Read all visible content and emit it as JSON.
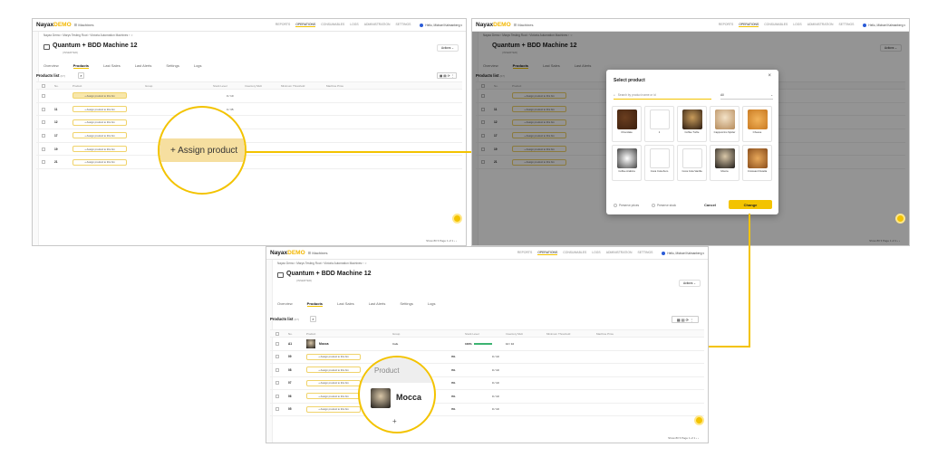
{
  "app": {
    "logo_main": "Nayax",
    "logo_accent": "DEMO",
    "app_name": "☰ Machines",
    "nav": [
      "REPORTS",
      "OPERATIONS",
      "CONSUMABLES",
      "LOGS",
      "ADMINISTRATION",
      "SETTINGS"
    ],
    "active_nav": "OPERATIONS",
    "user": "Hello, Michael Kalmanberg ▾"
  },
  "page": {
    "breadcrumbs": "Nayax Demo  ›  Marys Testing Root  ›  Victoria Automation Machines  ›  ☆",
    "title": "Quantum + BDD Machine 12",
    "subtitle": "(INSERTED)",
    "actions": "Actions ⌄",
    "tabs": [
      "Overview",
      "Products",
      "Last Sales",
      "Last Alerts",
      "Settings",
      "Logs"
    ],
    "active_tab": "Products",
    "products_list_label": "Products list",
    "products_count": "(07)",
    "columns": [
      "No.",
      "Product",
      "Group",
      "Stock Level",
      "Inventory Mult",
      "Minimum Threshold",
      "Machine Price"
    ],
    "assign_label": "+ Assign product to this bin",
    "status": "Show 80 ▾   Page 1 of 1   ‹  ›"
  },
  "panel1": {
    "rows": [
      {
        "no": "",
        "cap": "0 / 10"
      },
      {
        "no": "11",
        "cap": "0 / 35"
      },
      {
        "no": "12",
        "cap": "0 / 35"
      },
      {
        "no": "17",
        "cap": "0 / 10"
      },
      {
        "no": "19",
        "cap": "0 / 10"
      },
      {
        "no": "21",
        "cap": "0 / 10"
      }
    ],
    "fill_badge": "0%",
    "zoom_label": "+  Assign product"
  },
  "modal": {
    "title": "Select product",
    "search_placeholder": "Search by product name or id",
    "filter_value": "All",
    "close": "×",
    "products": [
      "Chocolate",
      "1",
      "Coffee Turtle",
      "Cappuccino Spider",
      "Cheese",
      "Coffee Arabica",
      "Coca Cola Zero",
      "Coca Cola Vanilla",
      "Mocca",
      "Croissant Nutella"
    ],
    "preserve_prices": "Preserve prices",
    "preserve_stock": "Preserve stock",
    "cancel": "Cancel",
    "change": "Change"
  },
  "panel3": {
    "rows": [
      {
        "no": "A1",
        "product": "Mocca",
        "group": "Cafe",
        "fill": "100%",
        "cap": "10 / 10"
      },
      {
        "no": "09",
        "product": "",
        "group": "",
        "fill": "0%",
        "cap": "0 / 10"
      },
      {
        "no": "08",
        "product": "",
        "group": "",
        "fill": "0%",
        "cap": "0 / 10"
      },
      {
        "no": "07",
        "product": "",
        "group": "",
        "fill": "0%",
        "cap": "0 / 10"
      },
      {
        "no": "06",
        "product": "",
        "group": "",
        "fill": "0%",
        "cap": "0 / 10"
      },
      {
        "no": "05",
        "product": "",
        "group": "",
        "fill": "0%",
        "cap": "0 / 10"
      }
    ],
    "zoom_header": "Product",
    "zoom_product": "Mocca"
  },
  "colors": {
    "accent": "#f3c300",
    "brand": "#f3b700",
    "dim": "#000000"
  }
}
